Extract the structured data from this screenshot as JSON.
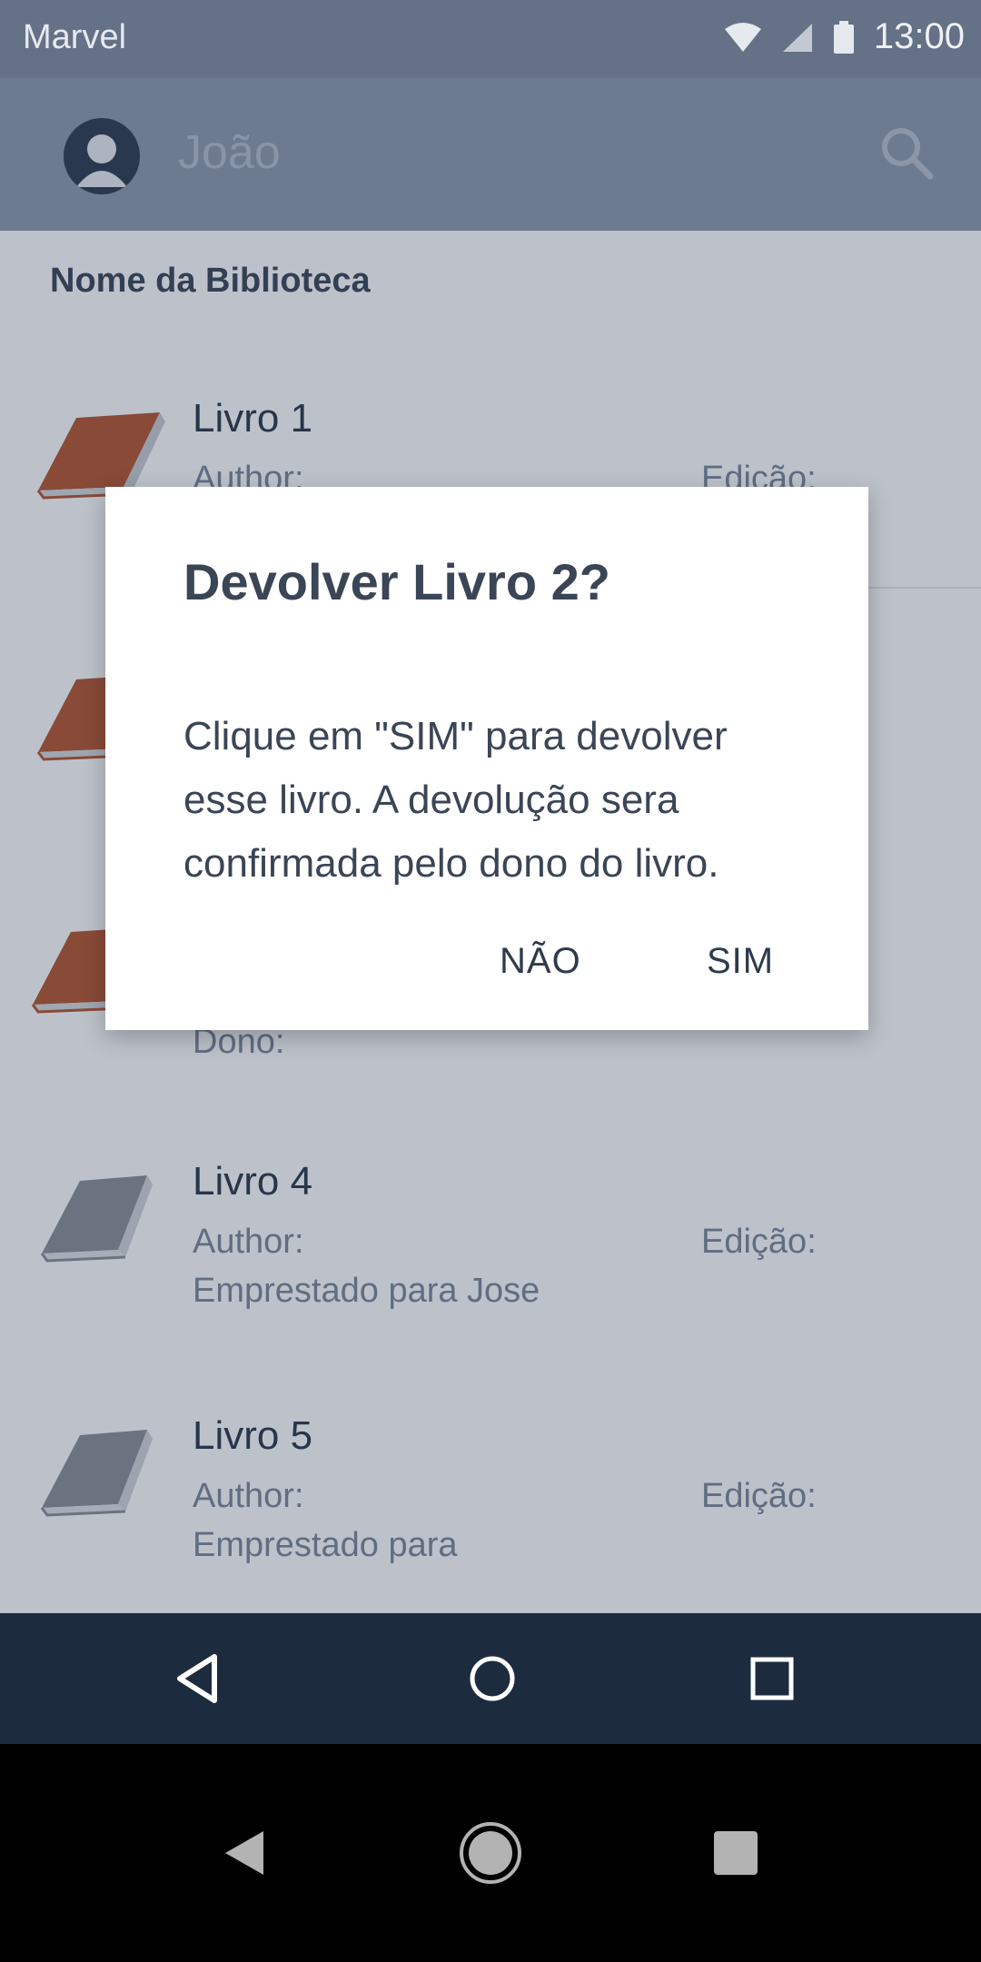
{
  "status_bar": {
    "carrier": "Marvel",
    "time": "13:00"
  },
  "app_bar": {
    "user_name": "João"
  },
  "library": {
    "section_title": "Nome da Biblioteca",
    "books": [
      {
        "title": "Livro 1",
        "author_label": "Author:",
        "edition_label": "Edição:",
        "status": "",
        "icon_color": "#b5532e"
      },
      {
        "title": "",
        "author_label": "",
        "edition_label": "",
        "status": "",
        "icon_color": "#b5532e"
      },
      {
        "title": "",
        "author_label": "",
        "edition_label": "",
        "status": "Dono:",
        "icon_color": "#b5532e"
      },
      {
        "title": "Livro 4",
        "author_label": "Author:",
        "edition_label": "Edição:",
        "status": "Emprestado para Jose",
        "icon_color": "#8a8f97"
      },
      {
        "title": "Livro 5",
        "author_label": "Author:",
        "edition_label": "Edição:",
        "status": "Emprestado para",
        "icon_color": "#8a8f97"
      }
    ]
  },
  "dialog": {
    "title": "Devolver Livro 2?",
    "message": "Clique em \"SIM\" para devolver esse livro. A devolução sera confirmada pelo dono do livro.",
    "no_label": "NÃO",
    "yes_label": "SIM"
  },
  "colors": {
    "status_bar": "#647186",
    "app_bar": "#8d9aac",
    "nav_bar": "#1d2b3f",
    "book_active": "#b5532e",
    "book_lent": "#8a8f97"
  },
  "icons": {
    "status": [
      "wifi-icon",
      "signal-icon",
      "battery-icon"
    ],
    "app_nav": [
      "back-icon",
      "home-icon",
      "recents-icon"
    ],
    "system_nav": [
      "back-icon",
      "home-icon",
      "recents-icon"
    ]
  }
}
